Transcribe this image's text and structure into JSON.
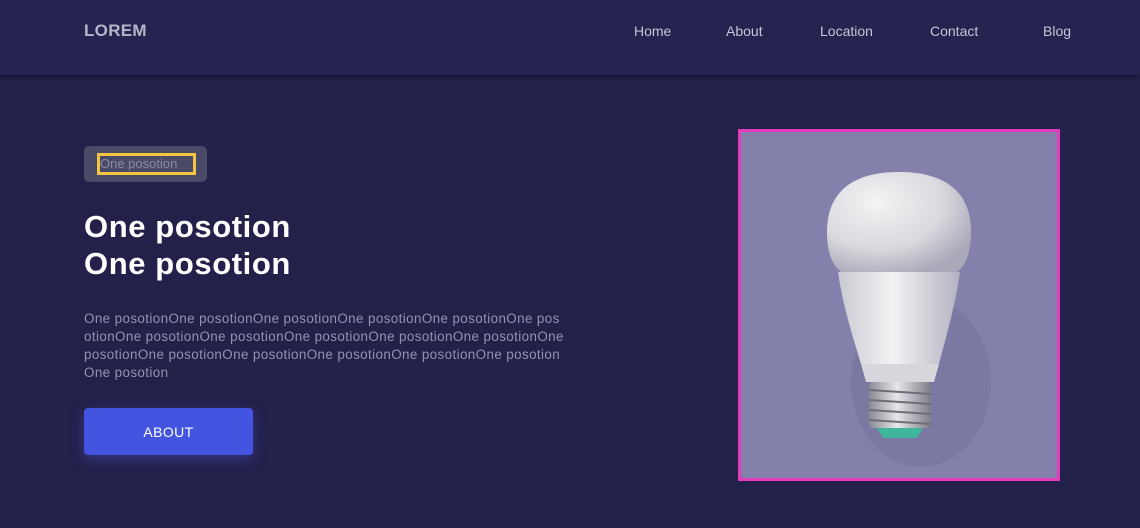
{
  "header": {
    "logo": "LOREM",
    "nav": [
      "Home",
      "About",
      "Location",
      "Contact",
      "Blog"
    ]
  },
  "hero": {
    "tag": "One posotion",
    "headline_line1": "One posotion",
    "headline_line2": "One posotion",
    "description": "One posotionOne posotionOne posotionOne posotionOne posotionOne posotionOne posotionOne posotionOne posotionOne posotionOne posotionOne posotionOne posotionOne posotionOne posotionOne posotionOne posotionOne posotion",
    "button_label": "ABOUT"
  },
  "image": {
    "icon": "lightbulb-image",
    "frame_color": "#e43bbd",
    "background_color": "#8380ac"
  },
  "colors": {
    "page_bg": "#232049",
    "accent_button": "#4354e0",
    "tag_highlight": "#f5c542"
  }
}
